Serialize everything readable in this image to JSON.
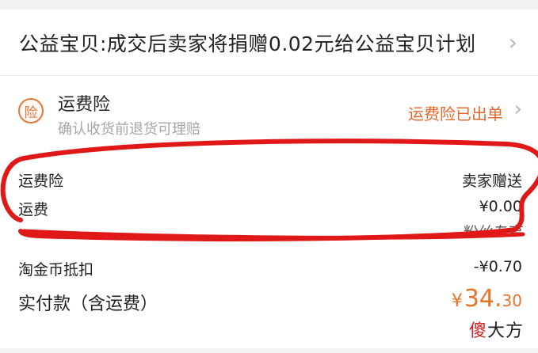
{
  "charity": {
    "text": "公益宝贝:成交后卖家将捐赠0.02元给公益宝贝计划",
    "chevron": "›"
  },
  "insurance": {
    "icon_char": "险",
    "icon_name": "insurance-icon",
    "title": "运费险",
    "subtitle": "确认收货前退货可理赔",
    "status": "运费险已出单",
    "chevron": "›"
  },
  "fees": {
    "insurance_label": "运费险",
    "insurance_value": "卖家赠送",
    "shipping_label": "运费",
    "shipping_value": "¥0.00",
    "fans_partial": "粉丝专享",
    "coin_label": "淘金币抵扣",
    "coin_value": "-¥0.70"
  },
  "payment": {
    "label": "实付款（含运费）",
    "currency": "¥",
    "amount_int": "34.",
    "amount_dec": "30"
  },
  "watermark": {
    "accent": "傻",
    "rest": "大方"
  },
  "colors": {
    "accent_orange": "#e0692e",
    "pay_orange": "#e8742a",
    "marker_red": "#e01818",
    "watermark_red": "#d42020"
  }
}
